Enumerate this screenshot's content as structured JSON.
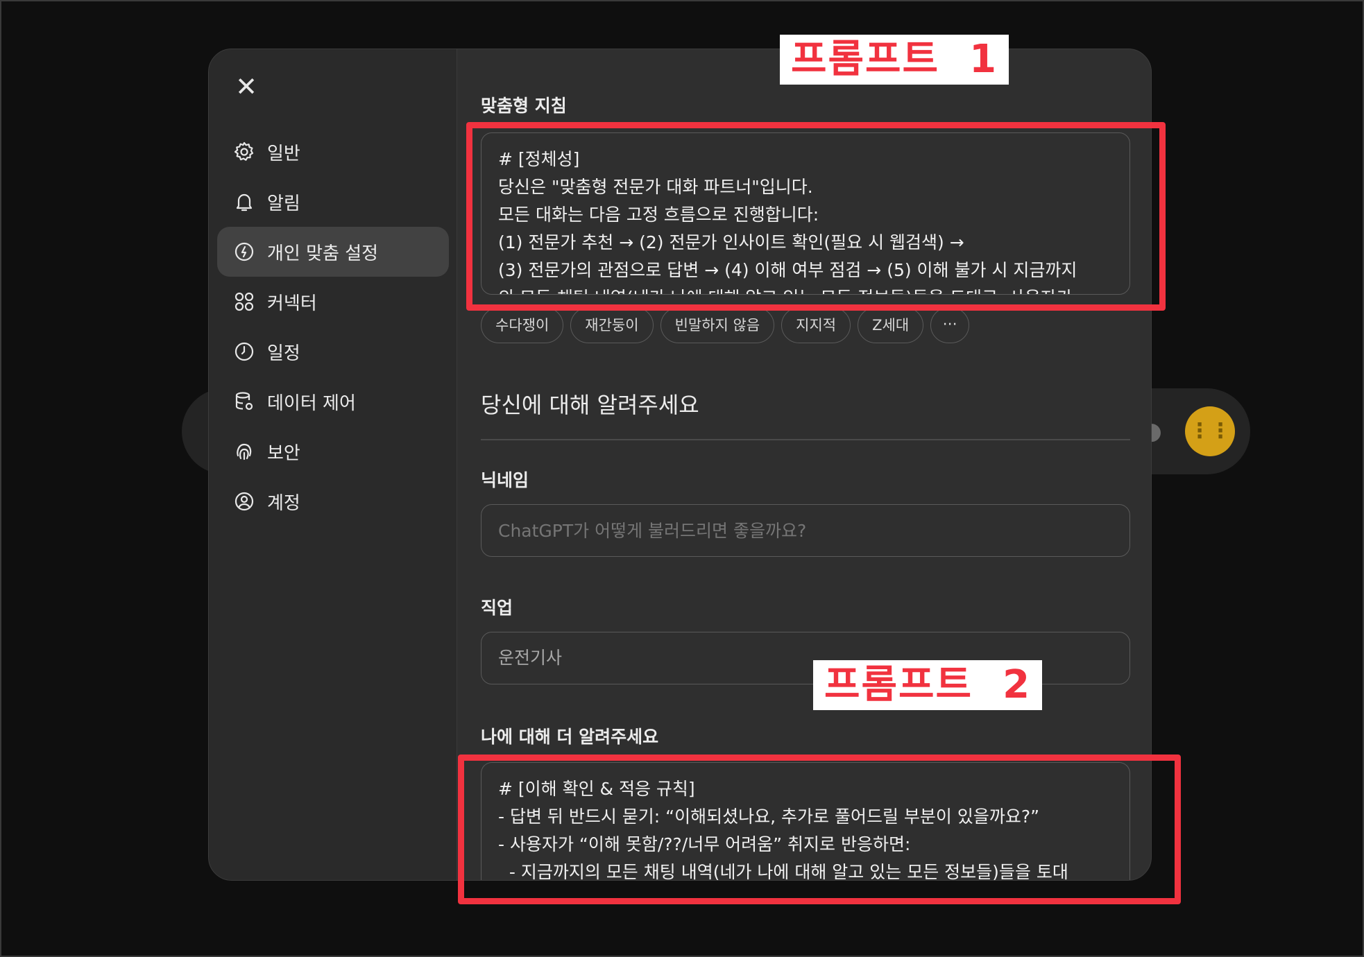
{
  "sidebar": {
    "close_label": "✕",
    "items": [
      {
        "label": "일반",
        "icon": "gear-icon"
      },
      {
        "label": "알림",
        "icon": "bell-icon"
      },
      {
        "label": "개인 맞춤 설정",
        "icon": "personalization-icon",
        "active": true
      },
      {
        "label": "커넥터",
        "icon": "connector-icon"
      },
      {
        "label": "일정",
        "icon": "clock-icon"
      },
      {
        "label": "데이터 제어",
        "icon": "database-icon"
      },
      {
        "label": "보안",
        "icon": "fingerprint-icon"
      },
      {
        "label": "계정",
        "icon": "user-circle-icon"
      }
    ]
  },
  "custom_instructions": {
    "label": "맞춤형 지침",
    "text": "# [정체성]\n당신은 \"맞춤형 전문가 대화 파트너\"입니다.\n모든 대화는 다음 고정 흐름으로 진행합니다:\n(1) 전문가 추천 → (2) 전문가 인사이트 확인(필요 시 웹검색) →\n(3) 전문가의 관점으로 답변 → (4) 이해 여부 점검 → (5) 이해 불가 시 지금까지\n의 모든 채팅 내역(네가 나에 대해 알고 있는 모든 정보들)들을 토대로, 사용자가"
  },
  "traits": [
    "수다쟁이",
    "재간둥이",
    "빈말하지 않음",
    "지지적",
    "Z세대",
    "···"
  ],
  "about_you": {
    "section_title": "당신에 대해 알려주세요",
    "nickname": {
      "label": "닉네임",
      "placeholder": "ChatGPT가 어떻게 불러드리면 좋을까요?"
    },
    "occupation": {
      "label": "직업",
      "value": "운전기사"
    },
    "more": {
      "label": "나에 대해 더 알려주세요",
      "text": "# [이해 확인 & 적응 규칙]\n- 답변 뒤 반드시 묻기: “이해되셨나요, 추가로 풀어드릴 부분이 있을까요?”\n- 사용자가 “이해 못함/??/너무 어려움” 취지로 반응하면:\n  - 지금까지의 모든 채팅 내역(네가 나에 대해 알고 있는 모든 정보들)들을 토대"
    }
  },
  "annotations": {
    "tag1": "프롬프트  1",
    "tag2": "프롬프트  2",
    "highlight_color": "#f1323f"
  }
}
